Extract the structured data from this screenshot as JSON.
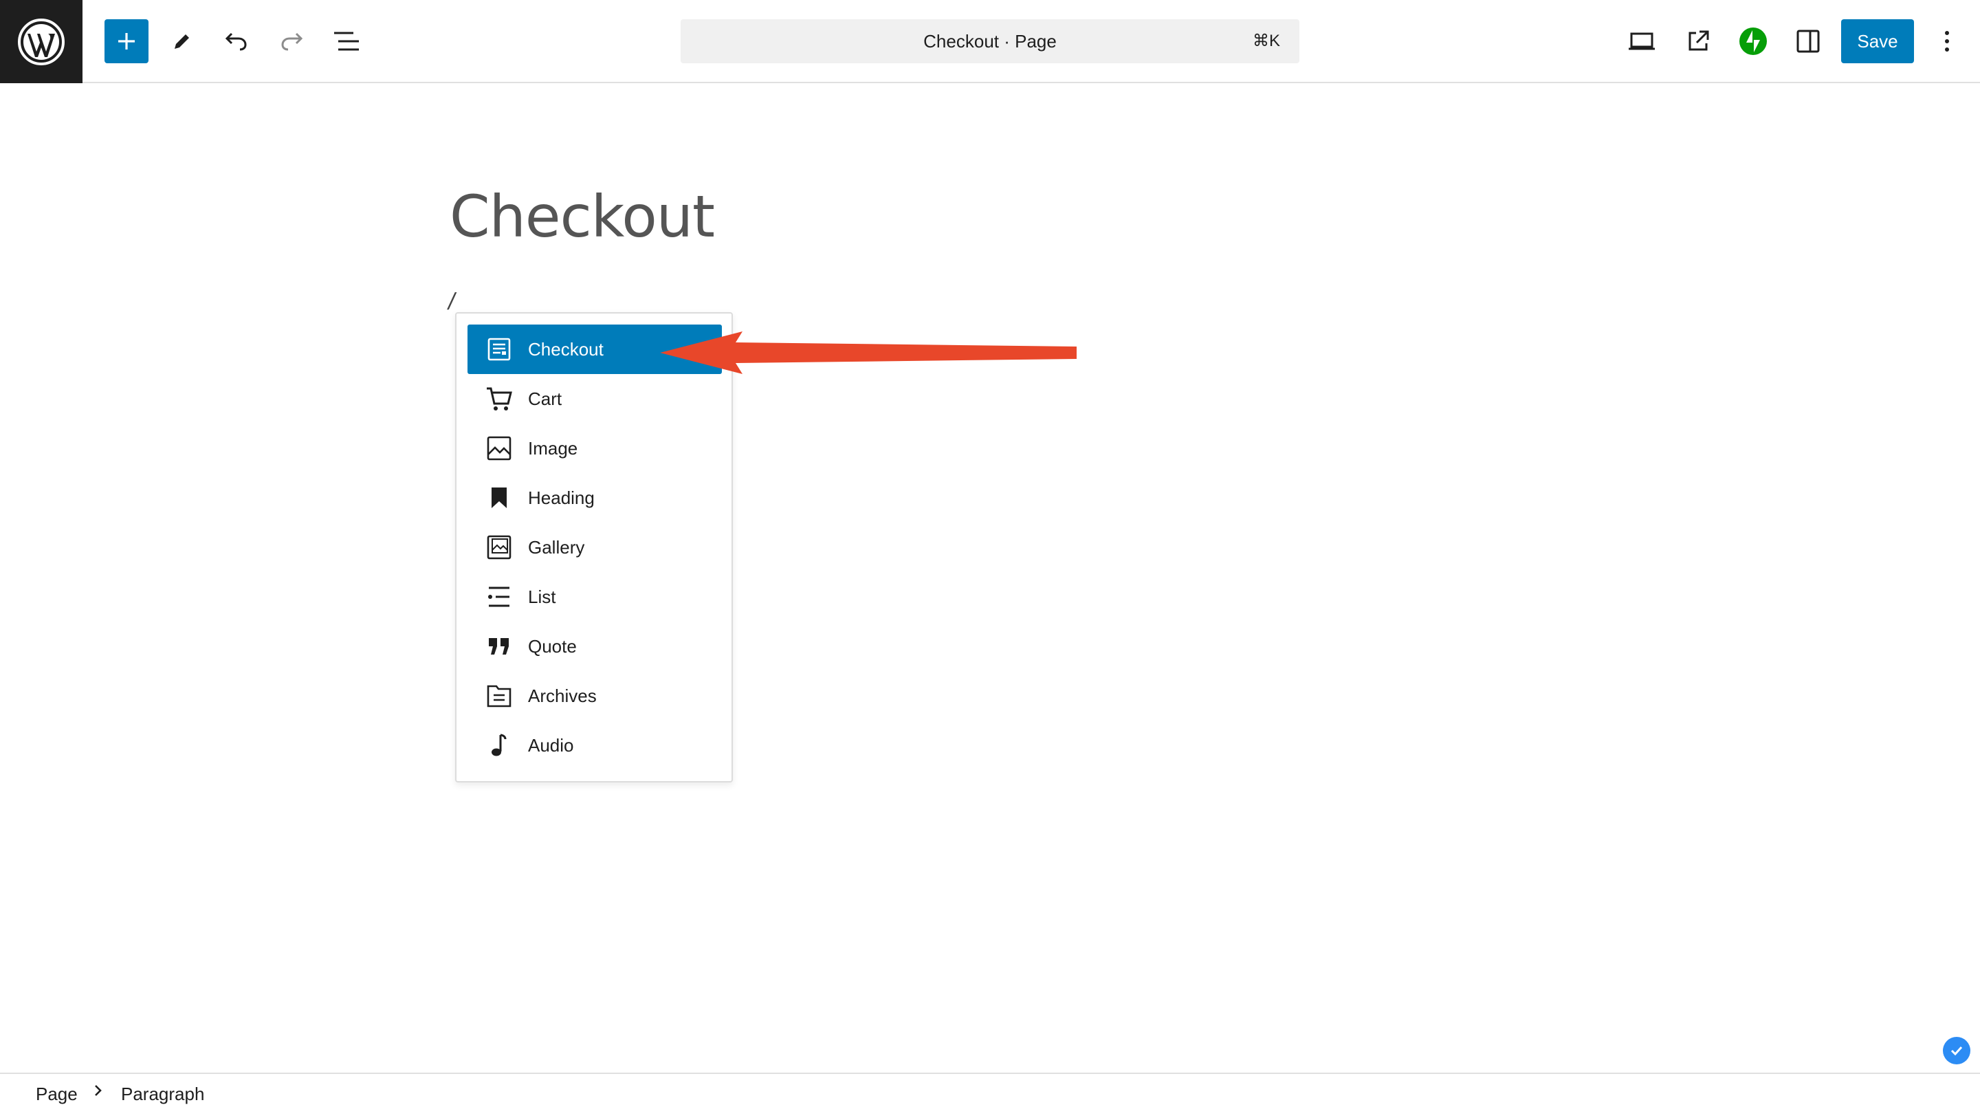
{
  "header": {
    "logo_icon": "wordpress-logo-icon",
    "inserter_icon": "plus-icon",
    "tools_icon": "pencil-icon",
    "undo_icon": "undo-icon",
    "redo_icon": "redo-icon",
    "list_view_icon": "list-view-icon",
    "command_bar": {
      "title": "Checkout · Page",
      "shortcut": "⌘K"
    },
    "preview_icon": "desktop-preview-icon",
    "view_page_icon": "external-link-icon",
    "jetpack_icon": "jetpack-icon",
    "settings_icon": "sidebar-settings-icon",
    "save_label": "Save",
    "more_icon": "vertical-ellipsis-icon"
  },
  "editor": {
    "title": "Checkout",
    "slash_text": "/"
  },
  "slash_menu": {
    "items": [
      {
        "label": "Checkout",
        "icon": "checkout-block-icon",
        "selected": true
      },
      {
        "label": "Cart",
        "icon": "cart-icon",
        "selected": false
      },
      {
        "label": "Image",
        "icon": "image-icon",
        "selected": false
      },
      {
        "label": "Heading",
        "icon": "bookmark-icon",
        "selected": false
      },
      {
        "label": "Gallery",
        "icon": "gallery-icon",
        "selected": false
      },
      {
        "label": "List",
        "icon": "list-icon",
        "selected": false
      },
      {
        "label": "Quote",
        "icon": "quote-icon",
        "selected": false
      },
      {
        "label": "Archives",
        "icon": "archive-icon",
        "selected": false
      },
      {
        "label": "Audio",
        "icon": "audio-icon",
        "selected": false
      }
    ]
  },
  "footer": {
    "breadcrumb": [
      "Page",
      "Paragraph"
    ]
  },
  "colors": {
    "accent": "#007cba",
    "annotation_arrow": "#e8472a",
    "jetpack_green": "#069e08",
    "logo_bg": "#1e1e1e"
  }
}
